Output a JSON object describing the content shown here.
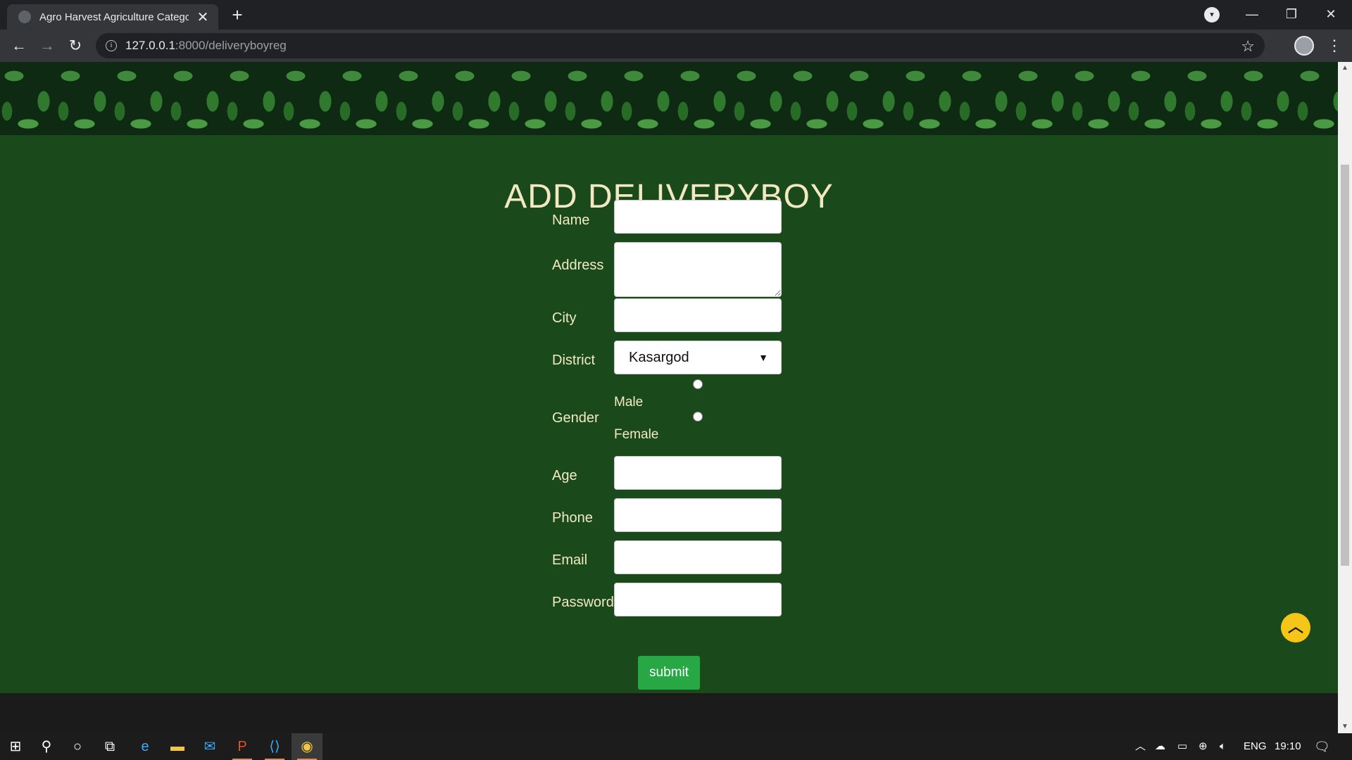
{
  "browser": {
    "tab_title": "Agro Harvest Agriculture Catego",
    "new_tab_symbol": "+",
    "url_host": "127.0.0.1",
    "url_rest": ":8000/deliveryboyreg"
  },
  "page": {
    "title": "ADD DELIVERYBOY",
    "labels": {
      "name": "Name",
      "address": "Address",
      "city": "City",
      "district": "District",
      "gender": "Gender",
      "age": "Age",
      "phone": "Phone",
      "email": "Email",
      "password": "Password"
    },
    "values": {
      "name": "",
      "address": "",
      "city": "",
      "age": "",
      "phone": "",
      "email": "",
      "password": ""
    },
    "district_selected": "Kasargod",
    "gender_options": [
      "Male",
      "Female"
    ],
    "submit_label": "submit"
  },
  "taskbar": {
    "language": "ENG",
    "time": "19:10"
  },
  "colors": {
    "page_bg": "#1a4a1c",
    "label_text": "#f2e9c2",
    "submit_bg": "#28a745",
    "back_to_top_bg": "#f5c518"
  }
}
